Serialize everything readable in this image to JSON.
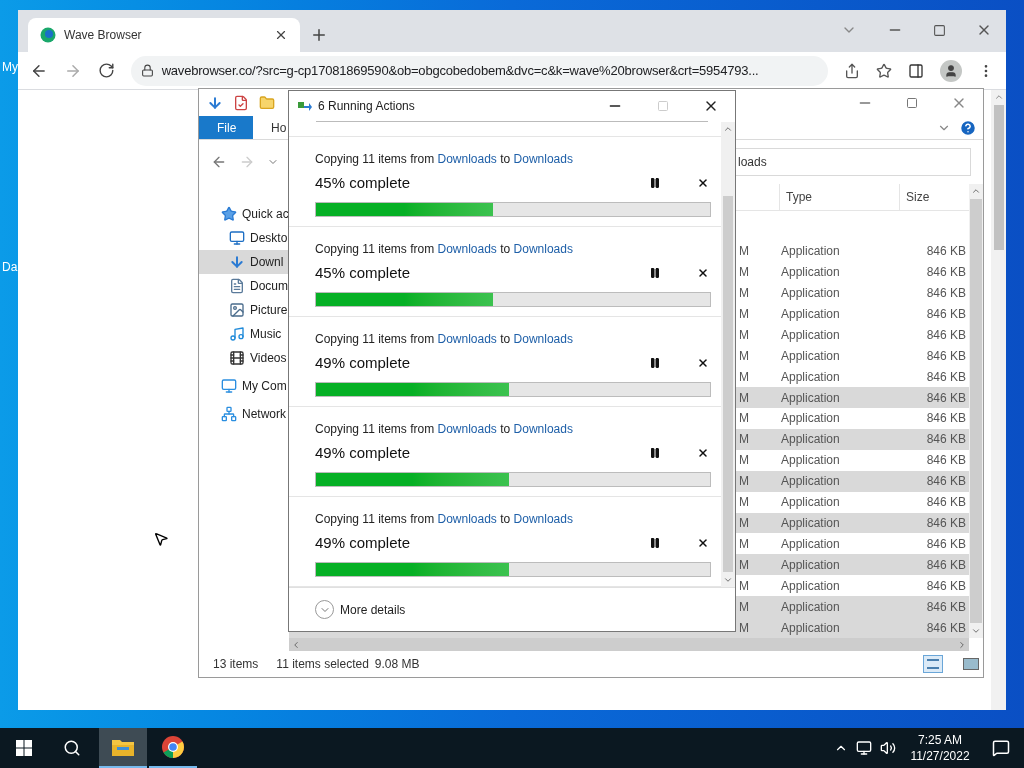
{
  "desktop": {
    "icon_labels": [
      "My",
      "Da"
    ]
  },
  "browser": {
    "tabs": [
      {
        "title": "Wave Browser",
        "selected": true
      }
    ],
    "url": "wavebrowser.co/?src=g-cp17081869590&ob=obgcobedobem&dvc=c&k=wave%20browser&crt=5954793..."
  },
  "explorer": {
    "ribbon_tabs": [
      {
        "label": "File",
        "selected": true
      },
      {
        "label": "Ho",
        "selected": false
      }
    ],
    "address_fragment": "loads",
    "nav_items": [
      {
        "label": "Quick ac",
        "selected": false
      },
      {
        "label": "Deskto",
        "selected": false
      },
      {
        "label": "Downl",
        "selected": true
      },
      {
        "label": "Docum",
        "selected": false
      },
      {
        "label": "Picture",
        "selected": false
      },
      {
        "label": "Music",
        "selected": false
      },
      {
        "label": "Videos",
        "selected": false
      },
      {
        "label": "My Com",
        "selected": false
      },
      {
        "label": "Network",
        "selected": false
      }
    ],
    "columns": [
      "Type",
      "Size"
    ],
    "rows": [
      {
        "date": "M",
        "type": "Application",
        "size": "846 KB",
        "selected": false
      },
      {
        "date": "M",
        "type": "Application",
        "size": "846 KB",
        "selected": false
      },
      {
        "date": "M",
        "type": "Application",
        "size": "846 KB",
        "selected": false
      },
      {
        "date": "M",
        "type": "Application",
        "size": "846 KB",
        "selected": false
      },
      {
        "date": "M",
        "type": "Application",
        "size": "846 KB",
        "selected": false
      },
      {
        "date": "M",
        "type": "Application",
        "size": "846 KB",
        "selected": false
      },
      {
        "date": "M",
        "type": "Application",
        "size": "846 KB",
        "selected": false
      },
      {
        "date": "M",
        "type": "Application",
        "size": "846 KB",
        "selected": true
      },
      {
        "date": "M",
        "type": "Application",
        "size": "846 KB",
        "selected": false
      },
      {
        "date": "M",
        "type": "Application",
        "size": "846 KB",
        "selected": true
      },
      {
        "date": "M",
        "type": "Application",
        "size": "846 KB",
        "selected": false
      },
      {
        "date": "M",
        "type": "Application",
        "size": "846 KB",
        "selected": true
      },
      {
        "date": "M",
        "type": "Application",
        "size": "846 KB",
        "selected": false
      },
      {
        "date": "M",
        "type": "Application",
        "size": "846 KB",
        "selected": true
      },
      {
        "date": "M",
        "type": "Application",
        "size": "846 KB",
        "selected": false
      },
      {
        "date": "M",
        "type": "Application",
        "size": "846 KB",
        "selected": true
      },
      {
        "date": "M",
        "type": "Application",
        "size": "846 KB",
        "selected": false
      },
      {
        "date": "M",
        "type": "Application",
        "size": "846 KB",
        "selected": true
      },
      {
        "date": "M",
        "type": "Application",
        "size": "846 KB",
        "selected": true
      }
    ],
    "status": {
      "count": "13 items",
      "selection": "11 items selected",
      "size": "9.08 MB"
    }
  },
  "dialog": {
    "title": "6 Running Actions",
    "actions": [
      {
        "verb": "Copying 11 items from",
        "source": "Downloads",
        "joiner": "to",
        "target": "Downloads",
        "progress": "45% complete",
        "level": 0.45
      },
      {
        "verb": "Copying 11 items from",
        "source": "Downloads",
        "joiner": "to",
        "target": "Downloads",
        "progress": "45% complete",
        "level": 0.45
      },
      {
        "verb": "Copying 11 items from",
        "source": "Downloads",
        "joiner": "to",
        "target": "Downloads",
        "progress": "49% complete",
        "level": 0.49
      },
      {
        "verb": "Copying 11 items from",
        "source": "Downloads",
        "joiner": "to",
        "target": "Downloads",
        "progress": "49% complete",
        "level": 0.49
      },
      {
        "verb": "Copying 11 items from",
        "source": "Downloads",
        "joiner": "to",
        "target": "Downloads",
        "progress": "49% complete",
        "level": 0.49
      }
    ],
    "more_details": "More details"
  },
  "taskbar": {
    "apps": [
      {
        "kind": "explorer",
        "selected": true
      },
      {
        "kind": "chrome",
        "selected": false
      }
    ],
    "time": "7:25 AM",
    "date": "11/27/2022"
  }
}
